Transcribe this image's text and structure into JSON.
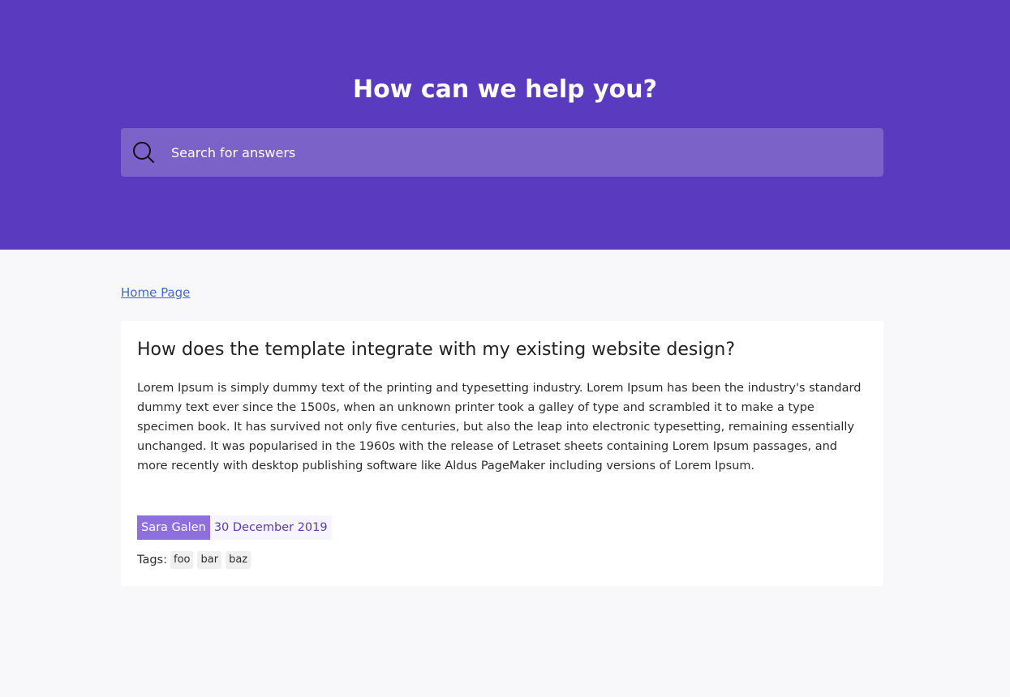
{
  "hero": {
    "title": "How can we help you?",
    "search_placeholder": "Search for answers",
    "background": "#5a3abf",
    "search_icon": "search-icon"
  },
  "breadcrumb": {
    "label": "Home Page"
  },
  "article": {
    "title": "How does the template integrate with my existing website design?",
    "body": "Lorem Ipsum is simply dummy text of the printing and typesetting industry. Lorem Ipsum has been the industry's standard dummy text ever since the 1500s, when an unknown printer took a galley of type and scrambled it to make a type specimen book. It has survived not only five centuries, but also the leap into electronic typesetting, remaining essentially unchanged. It was popularised in the 1960s with the release of Letraset sheets containing Lorem Ipsum passages, and more recently with desktop publishing software like Aldus PageMaker including versions of Lorem Ipsum.",
    "author": "Sara Galen",
    "date": "30 December 2019",
    "tags_label": "Tags:",
    "tags": [
      "foo",
      "bar",
      "baz"
    ]
  },
  "colors": {
    "accent": "#5a3abf",
    "author_badge": "#8e6fe0",
    "link": "#3c6bd6"
  }
}
